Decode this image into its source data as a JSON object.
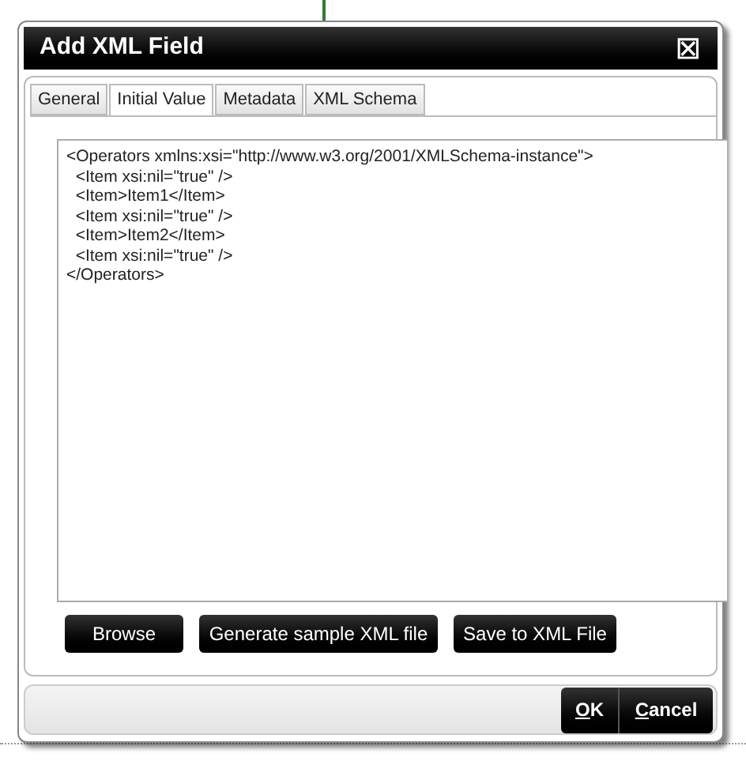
{
  "window": {
    "title": "Add XML Field",
    "close": "⊠"
  },
  "tabs": [
    {
      "label": "General",
      "selected": false
    },
    {
      "label": "Initial Value",
      "selected": true
    },
    {
      "label": "Metadata",
      "selected": false
    },
    {
      "label": "XML Schema",
      "selected": false
    }
  ],
  "editor": {
    "value": "<Operators xmlns:xsi=\"http://www.w3.org/2001/XMLSchema-instance\">\n  <Item xsi:nil=\"true\" />\n  <Item>Item1</Item>\n  <Item xsi:nil=\"true\" />\n  <Item>Item2</Item>\n  <Item xsi:nil=\"true\" />\n</Operators>"
  },
  "actions": [
    "Browse",
    "Generate sample XML file",
    "Save to XML File"
  ],
  "footer_buttons": [
    "OK",
    "Cancel"
  ]
}
